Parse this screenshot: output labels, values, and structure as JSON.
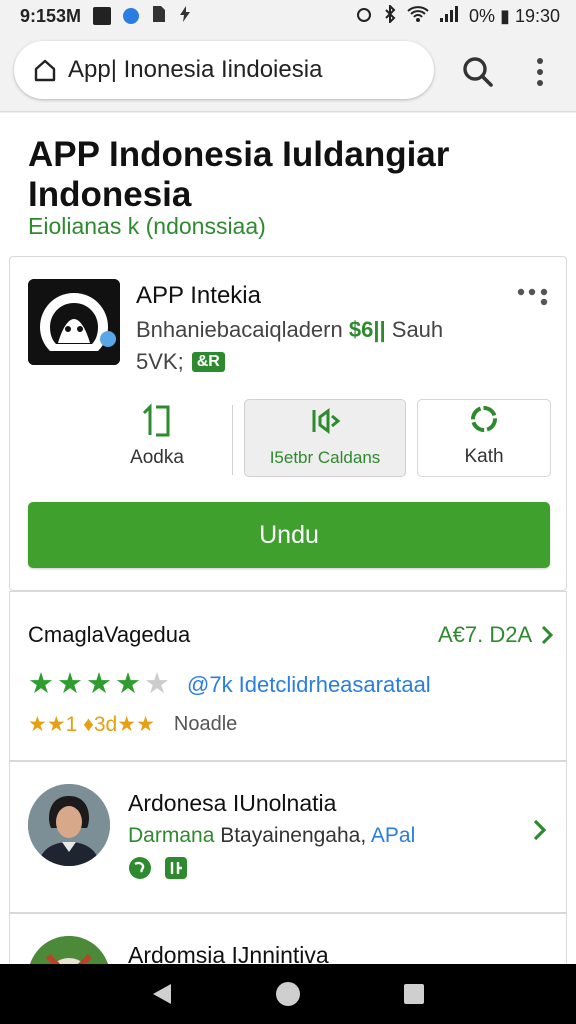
{
  "status_bar": {
    "time": "9:153M",
    "right_text": "0% ▮ 19:30",
    "icons": [
      "video-icon",
      "chrome-icon",
      "sim-icon",
      "bolt-icon",
      "alarm-icon",
      "bluetooth-icon",
      "wifi-icon",
      "signal-icon",
      "battery-icon"
    ]
  },
  "url_bar": {
    "url_text": "App| Inonesia Iindoiesia"
  },
  "page": {
    "title": "APP Indonesia Iuldangiar Indonesia",
    "subtitle": "Eiolianas k (ndonssiaa)"
  },
  "app_card": {
    "app_name": "APP Intekia",
    "meta_text": "Bnhaniebacaiqladern",
    "meta_highlight": "$6||",
    "meta_tail": "Sauh",
    "size_text": "5VK;",
    "size_badge": "&R",
    "actions": [
      {
        "label": "Aodka"
      },
      {
        "label": "I5etbr Caldans"
      },
      {
        "label": "Kath"
      }
    ],
    "install_label": "Undu",
    "colors": {
      "install": "#3fa02e",
      "accent": "#2e8a2e"
    }
  },
  "ratings_card": {
    "title": "CmaglaVagedua",
    "link_text": "A€7. D2A",
    "star_rating": 4,
    "star_max": 5,
    "count_text": "@7k Idetclidrheasarataal",
    "secondary_stars": "★★1 ♦3d★★",
    "secondary_note": "Noadle"
  },
  "developer_card": {
    "name": "Ardonesa IUnolnatia",
    "meta_green": "Darmana",
    "meta_mid": "Btayainengaha,",
    "meta_blue": "APal"
  },
  "developer_card_2": {
    "name": "Ardomsia IJnnintiva"
  }
}
